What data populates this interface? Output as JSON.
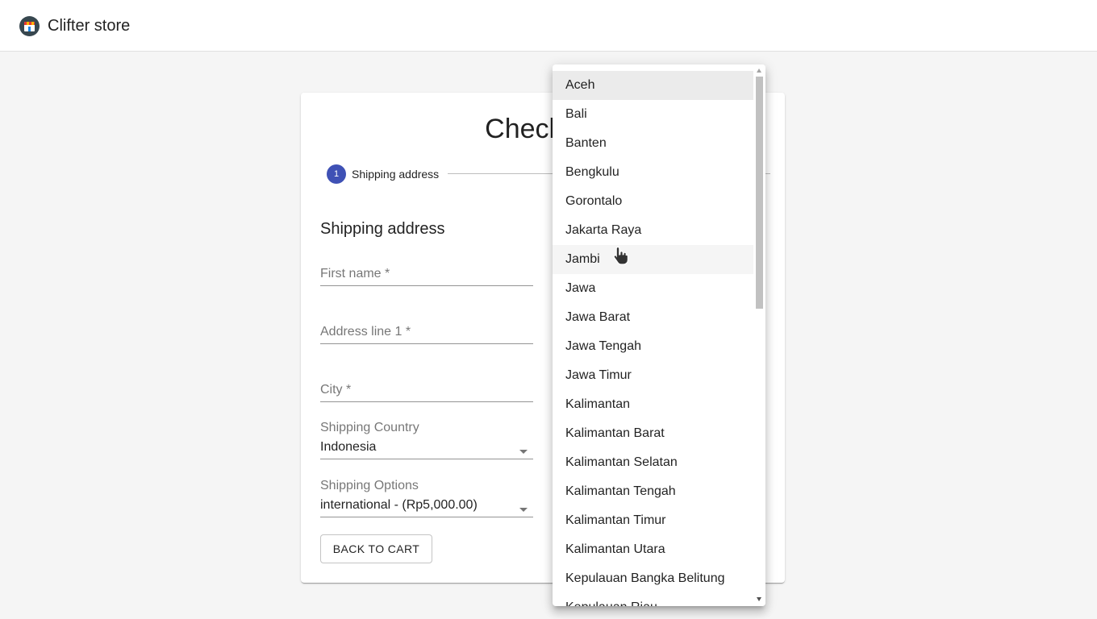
{
  "app": {
    "brand": "Clifter store",
    "logo_icon": "store-icon"
  },
  "checkout": {
    "title": "Checkout",
    "steps": [
      {
        "number": "1",
        "label": "Shipping address",
        "active": true
      }
    ],
    "section_title": "Shipping address",
    "fields": {
      "first_name": "First name *",
      "address_line1": "Address line 1 *",
      "city": "City *"
    },
    "shipping_country": {
      "label": "Shipping Country",
      "value": "Indonesia"
    },
    "shipping_options": {
      "label": "Shipping Options",
      "value": "international - (Rp5,000.00)"
    },
    "back_button": "Back to cart"
  },
  "subdivision_menu": {
    "items": [
      "Aceh",
      "Bali",
      "Banten",
      "Bengkulu",
      "Gorontalo",
      "Jakarta Raya",
      "Jambi",
      "Jawa",
      "Jawa Barat",
      "Jawa Tengah",
      "Jawa Timur",
      "Kalimantan",
      "Kalimantan Barat",
      "Kalimantan Selatan",
      "Kalimantan Tengah",
      "Kalimantan Timur",
      "Kalimantan Utara",
      "Kepulauan Bangka Belitung",
      "Kepulauan Riau"
    ],
    "selected": "Aceh",
    "hovered": "Jambi"
  },
  "colors": {
    "primary": "#3f51b5",
    "background": "#f5f5f5",
    "selected_item": "#ebebeb"
  }
}
